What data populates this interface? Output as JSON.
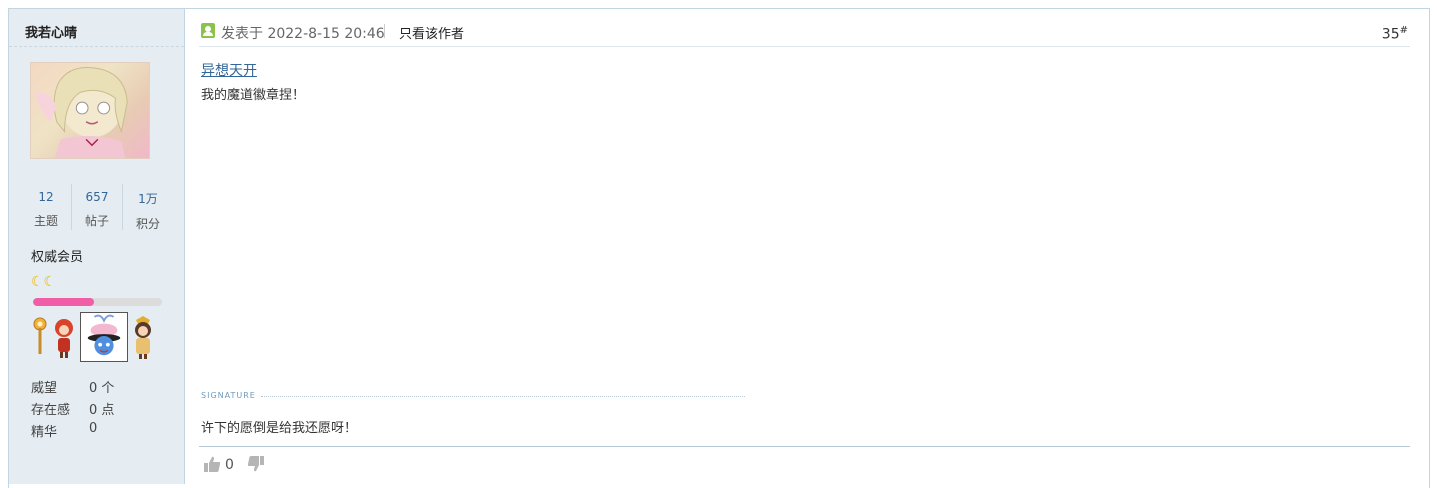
{
  "author": {
    "name": "我若心晴",
    "stats": [
      {
        "value": "12",
        "label": "主题"
      },
      {
        "value": "657",
        "label": "帖子"
      },
      {
        "value": "1万",
        "label": "积分"
      }
    ],
    "group": "权威会员",
    "stars": "☾☾",
    "level_progress": 0.47,
    "meta": [
      {
        "key": "威望",
        "value": "0 个"
      },
      {
        "key": "存在感",
        "value": "0 点"
      },
      {
        "key": "精华",
        "value": "0"
      }
    ]
  },
  "post": {
    "posted_at": "发表于 2022-8-15 20:46",
    "only_author": "只看该作者",
    "floor": "35",
    "floor_sup": "#",
    "title": "异想天开",
    "content": "我的魔道徽章捏！",
    "signature_label": "SIGNATURE",
    "signature": "许下的愿倒是给我还愿呀！",
    "like_count": "0"
  },
  "colors": {
    "sidebar_bg": "#e5edf2",
    "link": "#336699",
    "progress": "#f05ea8",
    "online_icon": "#8bc34a"
  }
}
